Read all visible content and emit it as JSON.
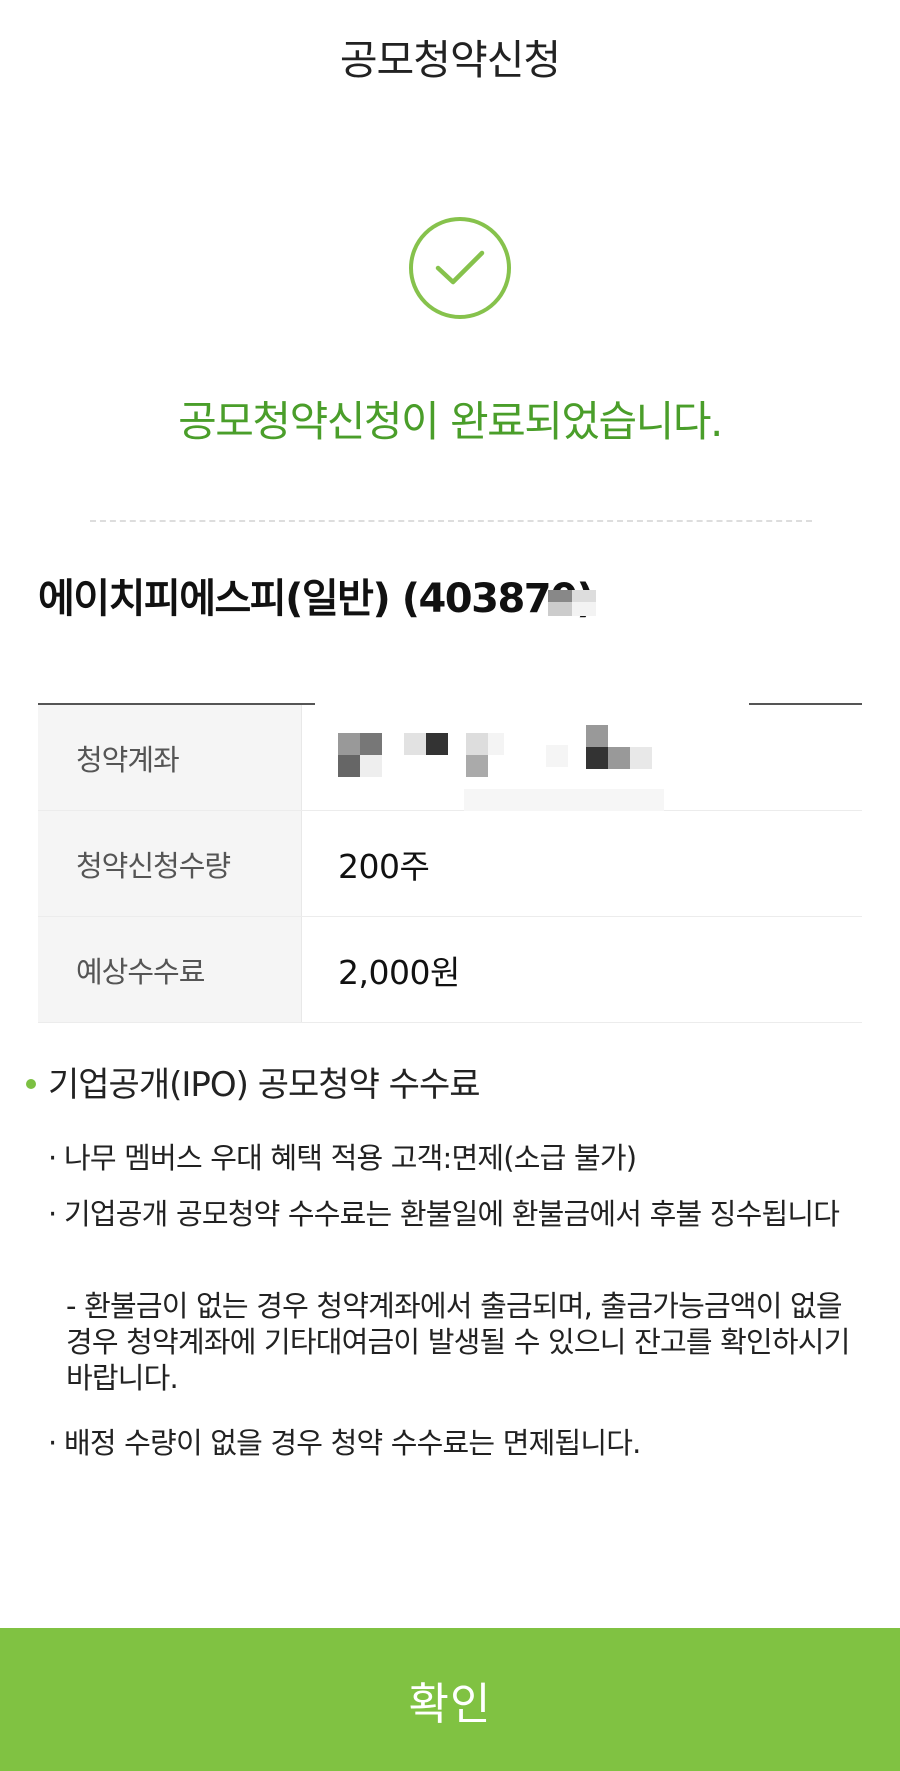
{
  "header": {
    "title": "공모청약신청"
  },
  "status": {
    "icon": "check-circle-icon",
    "message": "공모청약신청이 완료되었습니다.",
    "accent_color": "#4a9e2a"
  },
  "stock": {
    "name": "에이치피에스피(일반) (403870)"
  },
  "details": {
    "rows": [
      {
        "label": "청약계좌",
        "value": ""
      },
      {
        "label": "청약신청수량",
        "value": "200주"
      },
      {
        "label": "예상수수료",
        "value": "2,000원"
      }
    ]
  },
  "fee_info": {
    "heading": "기업공개(IPO) 공모청약 수수료",
    "notes": [
      {
        "bullet": "·",
        "text": "나무 멤버스 우대 혜택 적용 고객:면제(소급 불가)"
      },
      {
        "bullet": "·",
        "text": "기업공개 공모청약 수수료는 환불일에 환불금에서 후불 징수됩니다"
      }
    ],
    "sub_note": "- 환불금이 없는 경우 청약계좌에서 출금되며, 출금가능금액이 없을 경우 청약계좌에 기타대여금이 발생될 수 있으니 잔고를 확인하시기 바랍니다.",
    "last_note": {
      "bullet": "·",
      "text": "배정 수량이 없을 경우 청약 수수료는 면제됩니다."
    }
  },
  "footer": {
    "confirm_label": "확인",
    "button_color": "#80c242"
  }
}
